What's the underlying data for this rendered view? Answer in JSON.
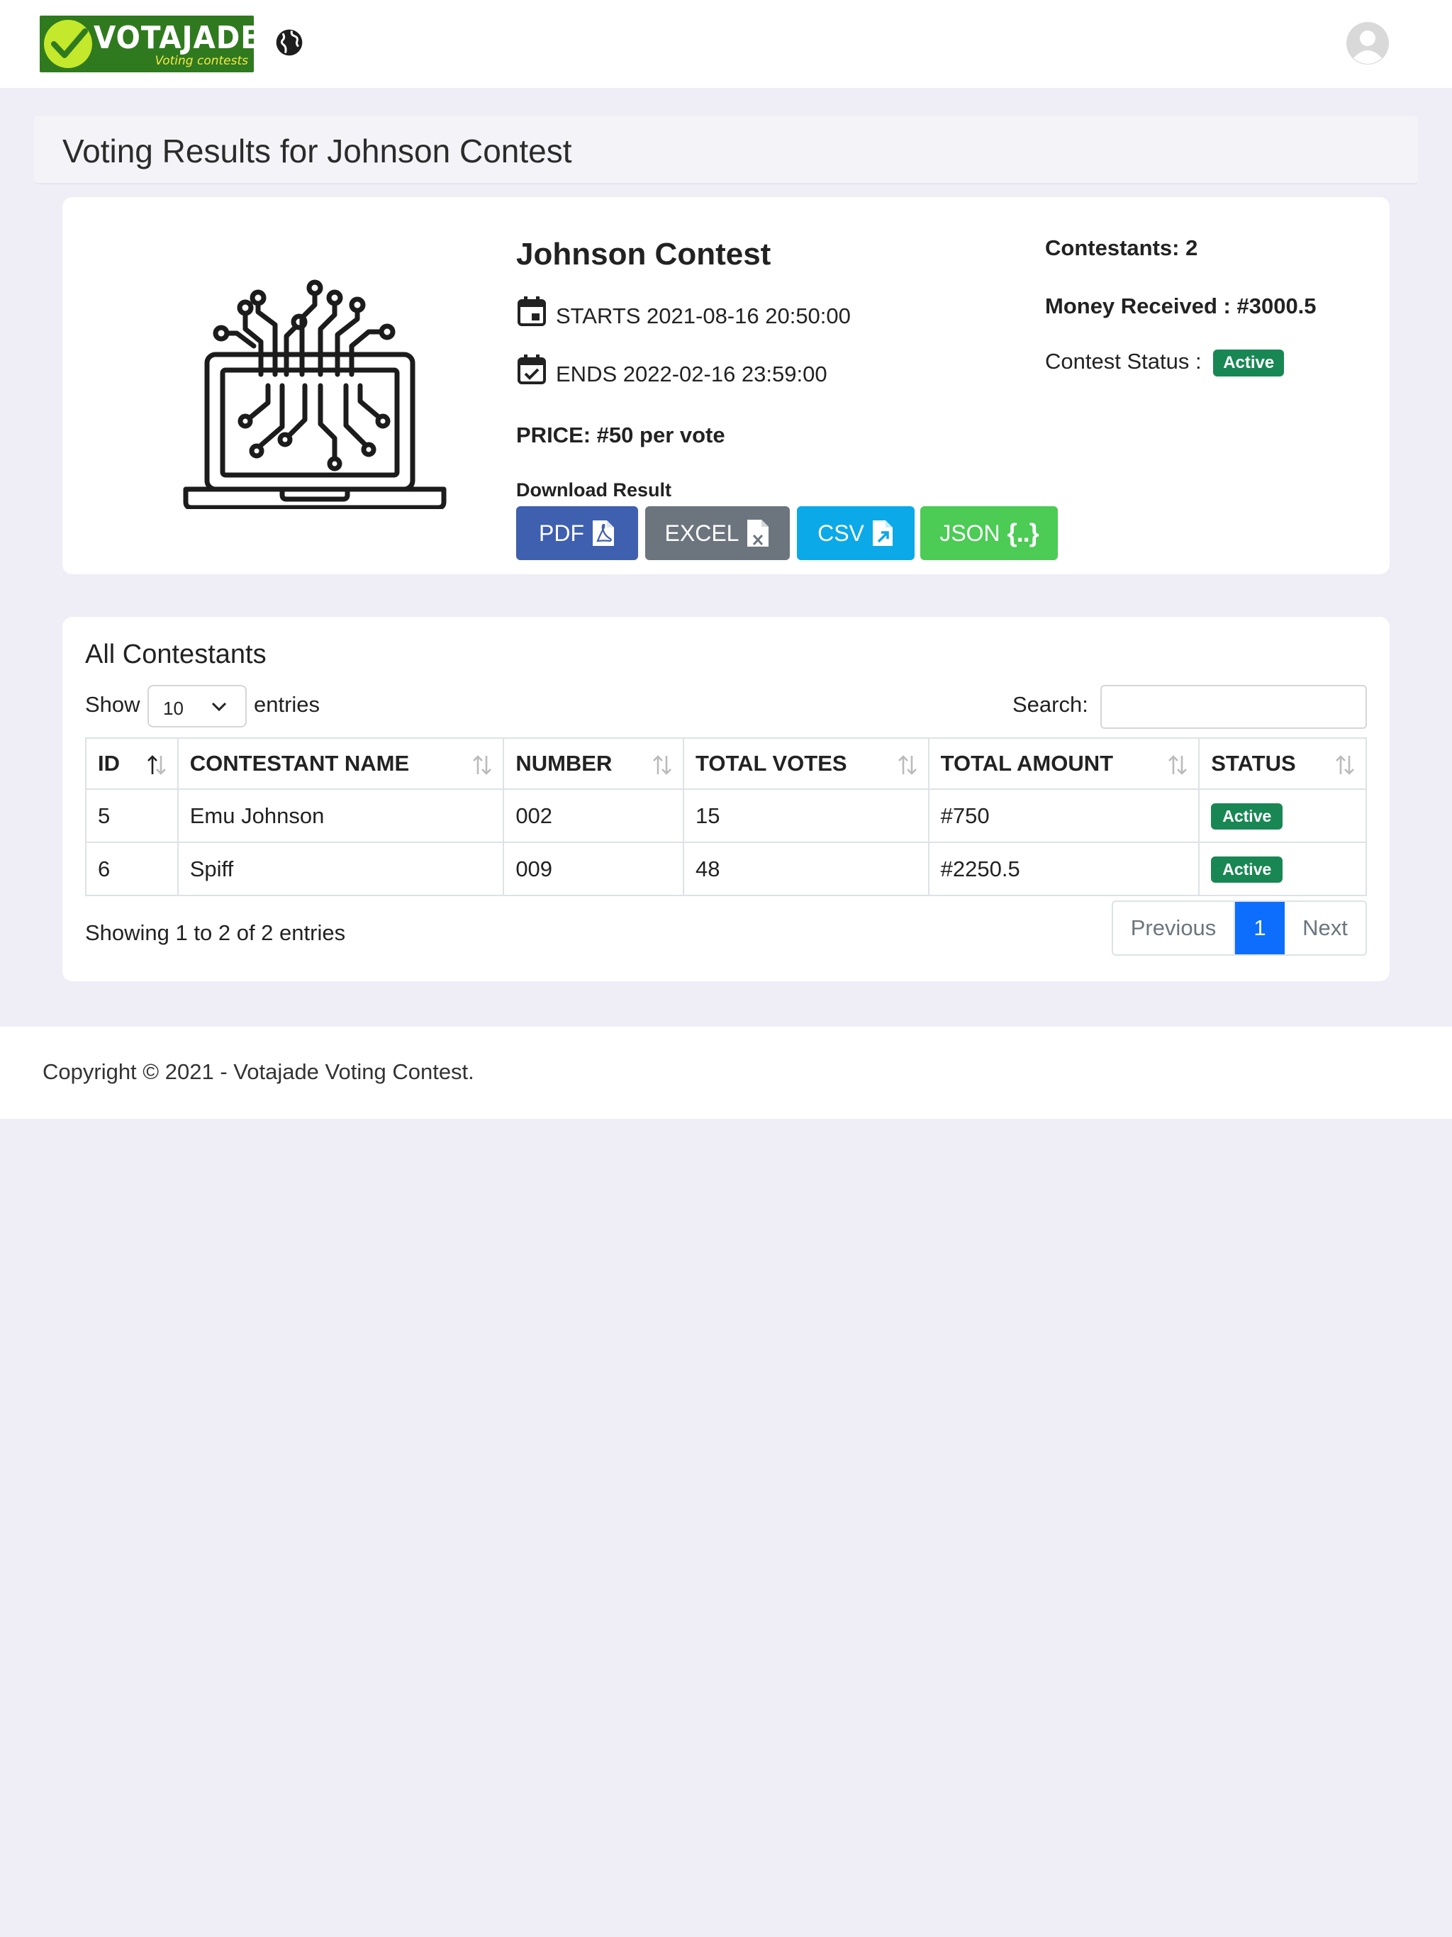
{
  "brand": {
    "name": "VOTAJADE",
    "tagline": "Voting contests"
  },
  "page": {
    "title": "Voting Results for Johnson Contest"
  },
  "contest": {
    "name": "Johnson Contest",
    "starts": "STARTS 2021-08-16 20:50:00",
    "ends": "ENDS 2022-02-16 23:59:00",
    "price": "PRICE: #50 per vote",
    "download_label": "Download Result",
    "downloads": {
      "pdf": "PDF",
      "excel": "EXCEL",
      "csv": "CSV",
      "json": "JSON",
      "json_icon": "{..}"
    },
    "contestants_count": "Contestants: 2",
    "money_received": "Money Received : #3000.5",
    "status_label": "Contest Status :",
    "status": "Active"
  },
  "contestants": {
    "title": "All Contestants",
    "show_label": "Show",
    "entries_value": "10",
    "entries_label": "entries",
    "search_label": "Search:",
    "search_value": "",
    "columns": [
      "ID",
      "CONTESTANT NAME",
      "NUMBER",
      "TOTAL VOTES",
      "TOTAL AMOUNT",
      "STATUS"
    ],
    "rows": [
      {
        "id": "5",
        "name": "Emu Johnson",
        "number": "002",
        "votes": "15",
        "amount": "#750",
        "status": "Active"
      },
      {
        "id": "6",
        "name": "Spiff",
        "number": "009",
        "votes": "48",
        "amount": "#2250.5",
        "status": "Active"
      }
    ],
    "info": "Showing 1 to 2 of 2 entries",
    "pagination": {
      "previous": "Previous",
      "current": "1",
      "next": "Next"
    }
  },
  "footer": {
    "copyright": "Copyright © 2021 - Votajade Voting Contest."
  },
  "colors": {
    "pdf": "#3f5faf",
    "excel": "#6c757d",
    "csv": "#0ba9e8",
    "json": "#4ccb55",
    "active_badge": "#198754",
    "pagination_active": "#0d6efd",
    "page_background": "#efedf6"
  },
  "icons": {
    "logo": "check-circle-logo",
    "globe": "globe-icon",
    "avatar": "user-avatar-icon",
    "starts": "calendar-icon",
    "ends": "calendar-check-icon",
    "pdf": "file-pdf-icon",
    "excel": "file-excel-icon",
    "csv": "file-export-icon",
    "sort": "sort-arrows-icon",
    "select": "chevron-down-icon",
    "illustration": "laptop-circuit-illustration"
  }
}
